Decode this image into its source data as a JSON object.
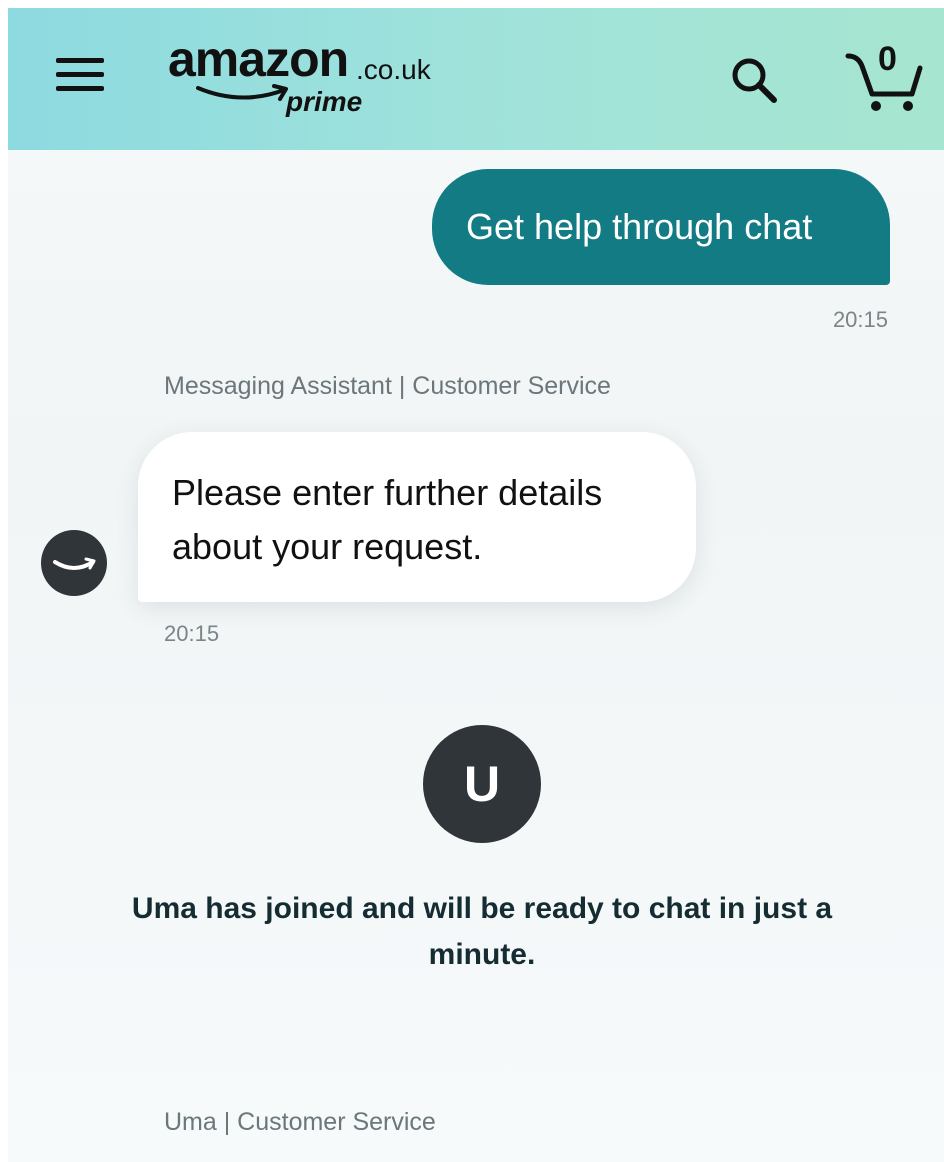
{
  "header": {
    "logo": {
      "main": "amazon",
      "domain": ".co.uk",
      "sub": "prime"
    },
    "cart_count": "0"
  },
  "messages": [
    {
      "text": "Get help through chat",
      "time": "20:15"
    },
    {
      "sender": "Messaging Assistant | Customer Service",
      "text": "Please enter further details about your request.",
      "time": "20:15"
    }
  ],
  "system": {
    "avatar_initial": "U",
    "text": "Uma has joined and will be ready to chat in just a minute."
  },
  "next_sender": "Uma | Customer Service",
  "colors": {
    "header_gradient_start": "#8ddae0",
    "header_gradient_end": "#a6e5cf",
    "user_bubble": "#137b84",
    "avatar": "#2f3538"
  }
}
